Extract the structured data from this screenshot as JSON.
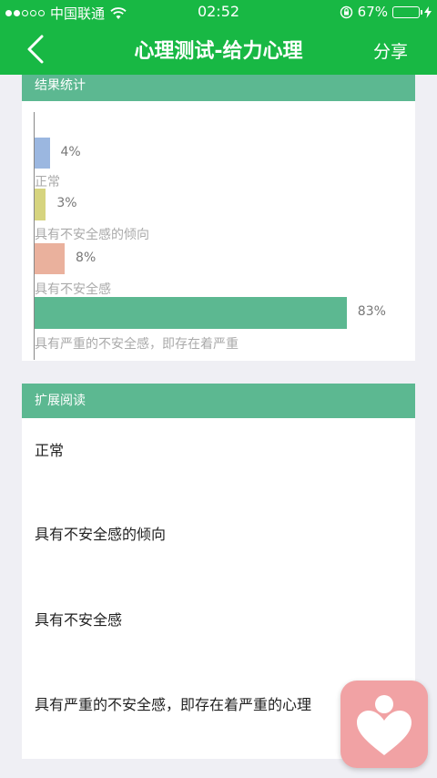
{
  "status_bar": {
    "carrier": "中国联通",
    "time": "02:52",
    "battery": "67%",
    "battery_level": 0.67
  },
  "nav": {
    "title": "心理测试-给力心理",
    "share_label": "分享"
  },
  "result_card": {
    "header": "结果统计",
    "chart_data": {
      "type": "bar",
      "orientation": "horizontal",
      "categories": [
        "正常",
        "具有不安全感的倾向",
        "具有不安全感",
        "具有严重的不安全感，即存在着严重"
      ],
      "values": [
        4,
        3,
        8,
        83
      ],
      "value_labels": [
        "4%",
        "3%",
        "8%",
        "83%"
      ],
      "colors": [
        "#9bb7e0",
        "#d6d47f",
        "#eab19d",
        "#5cb891"
      ],
      "xlim": [
        0,
        100
      ]
    }
  },
  "reading_card": {
    "header": "扩展阅读",
    "items": [
      "正常",
      "具有不安全感的倾向",
      "具有不安全感",
      "具有严重的不安全感，即存在着严重的心理"
    ]
  }
}
